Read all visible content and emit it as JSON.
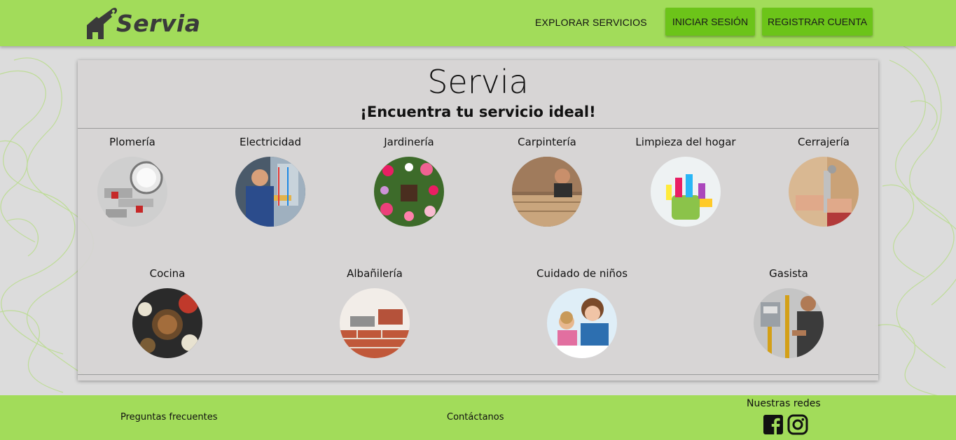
{
  "brand": {
    "name": "Servia",
    "logo_icon": "wrench-house-icon"
  },
  "nav": {
    "explore": "EXPLORAR SERVICIOS",
    "login": "INICIAR SESIÓN",
    "register": "REGISTRAR CUENTA"
  },
  "hero": {
    "title": "Servia",
    "subtitle": "¡Encuentra tu servicio ideal!"
  },
  "services": [
    {
      "label": "Plomería",
      "image": "plumbing-photo"
    },
    {
      "label": "Electricidad",
      "image": "electricity-photo"
    },
    {
      "label": "Jardinería",
      "image": "gardening-photo"
    },
    {
      "label": "Carpintería",
      "image": "carpentry-photo"
    },
    {
      "label": "Limpieza del hogar",
      "image": "cleaning-photo"
    },
    {
      "label": "Cerrajería",
      "image": "locksmith-photo"
    },
    {
      "label": "Cocina",
      "image": "cooking-photo"
    },
    {
      "label": "Albañilería",
      "image": "masonry-photo"
    },
    {
      "label": "Cuidado de niños",
      "image": "childcare-photo"
    },
    {
      "label": "Gasista",
      "image": "gas-fitter-photo"
    }
  ],
  "footer": {
    "faq": "Preguntas frecuentes",
    "contact": "Contáctanos",
    "social_title": "Nuestras redes",
    "social": [
      "facebook-icon",
      "instagram-icon"
    ]
  },
  "colors": {
    "header_bg": "#a2dc5a",
    "button_bg": "#6cc419",
    "card_bg": "#d6d4d4"
  }
}
